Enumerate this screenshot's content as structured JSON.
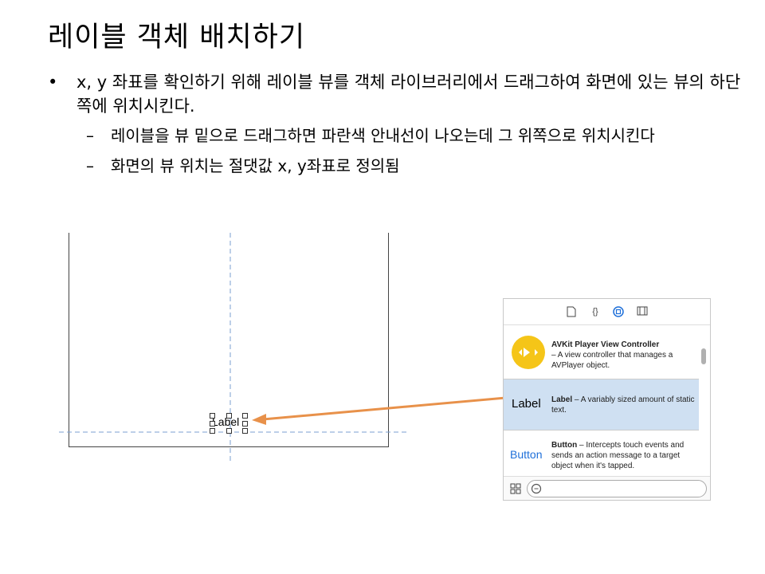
{
  "slide": {
    "title": "레이블 객체 배치하기",
    "bullet_symbol": "•",
    "bullet_main": "x, y 좌표를 확인하기 위해 레이블 뷰를 객체 라이브러리에서 드래그하여 화면에 있는 뷰의 하단 쪽에 위치시킨다.",
    "dash_symbol": "–",
    "sub_bullets": [
      "레이블을 뷰 밑으로 드래그하면 파란색 안내선이 나오는데 그 위쪽으로 위치시킨다",
      "화면의 뷰 위치는 절댓값 x, y좌표로 정의됨"
    ]
  },
  "canvas": {
    "placed_label": "Label",
    "guide_color": "#7b9fd0",
    "arrow_color": "#e8914a"
  },
  "library": {
    "toolbar_icons": [
      "file-template-icon",
      "code-snippet-icon",
      "object-icon",
      "media-icon"
    ],
    "code_snippet_glyph": "{}",
    "items": [
      {
        "preview_icon": "avkit-player-icon",
        "name": "AVKit Player View Controller",
        "description": "– A view controller that manages a AVPlayer object."
      },
      {
        "preview_text": "Label",
        "name": "Label",
        "description": "– A variably sized amount of static text.",
        "selected": true
      },
      {
        "preview_text": "Button",
        "name": "Button",
        "description": "– Intercepts touch events and sends an action message to a target object when it's tapped."
      }
    ],
    "selected_bg": "#cfe0f2",
    "accent": "#1e6fd9",
    "avkit_color": "#f5c518"
  }
}
